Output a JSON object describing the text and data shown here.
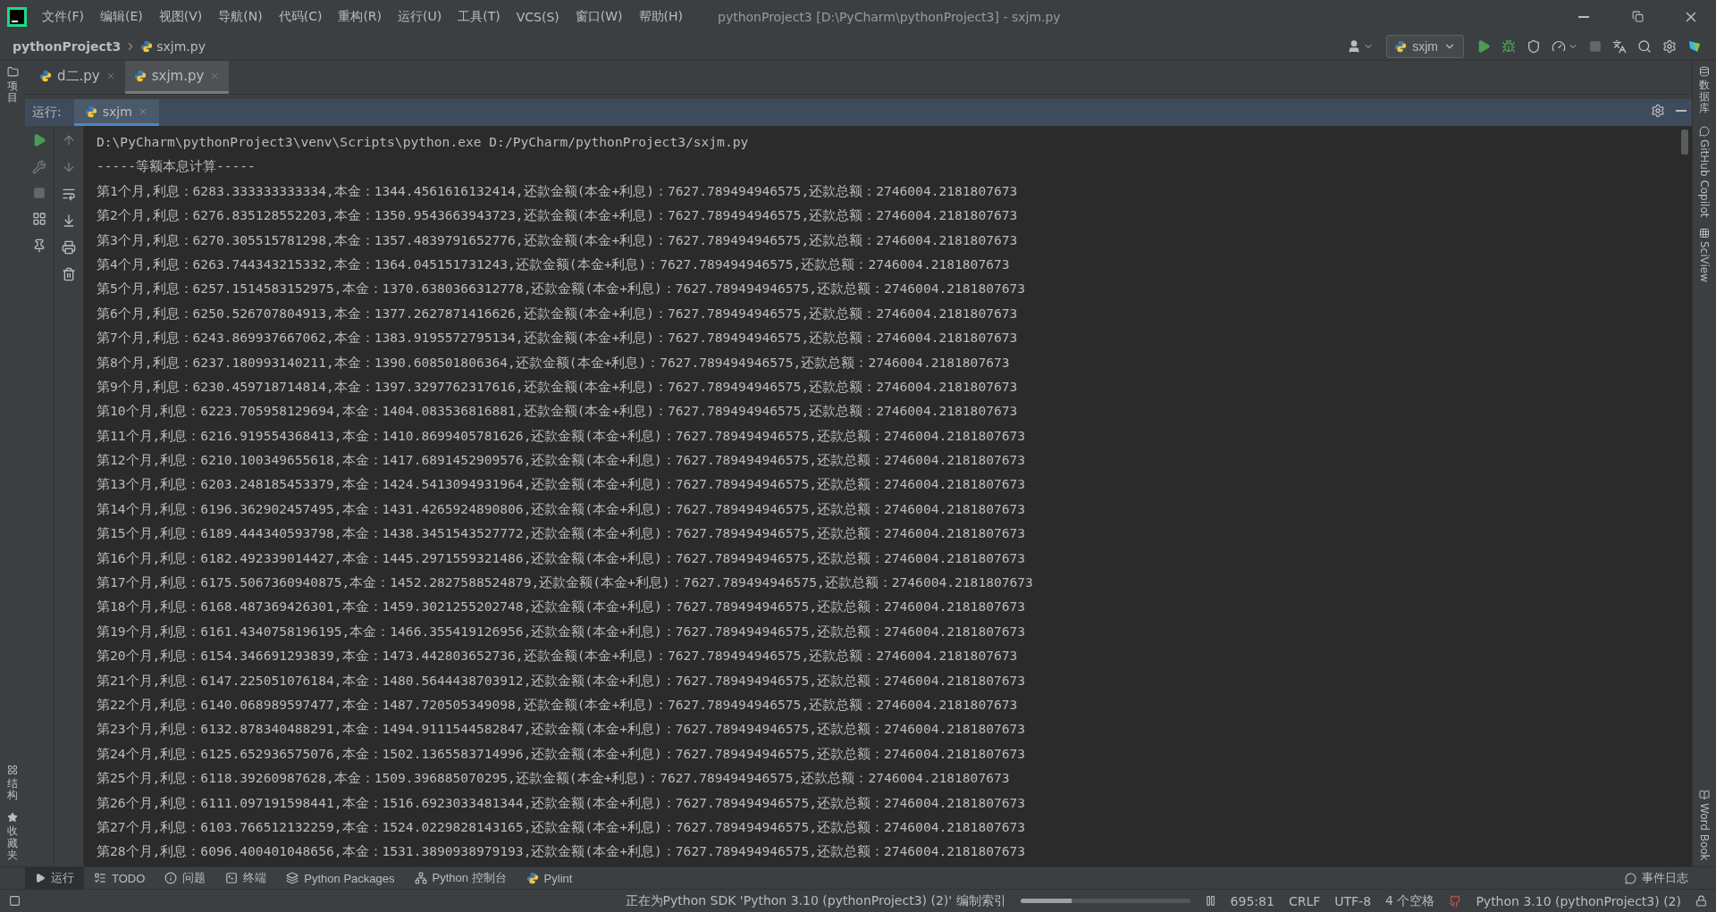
{
  "window": {
    "title": "pythonProject3 [D:\\PyCharm\\pythonProject3] - sxjm.py"
  },
  "menu": [
    "文件(F)",
    "编辑(E)",
    "视图(V)",
    "导航(N)",
    "代码(C)",
    "重构(R)",
    "运行(U)",
    "工具(T)",
    "VCS(S)",
    "窗口(W)",
    "帮助(H)"
  ],
  "breadcrumb": [
    "pythonProject3",
    "sxjm.py"
  ],
  "run_config": "sxjm",
  "editor_tabs": [
    {
      "label": "d二.py",
      "selected": false
    },
    {
      "label": "sxjm.py",
      "selected": true
    }
  ],
  "left_strip": {
    "top": [
      "项目"
    ],
    "bottom": [
      "结构",
      "收藏夹"
    ]
  },
  "right_strip": [
    "数据库",
    "GitHub Copilot",
    "SciView",
    "Word Book"
  ],
  "run_panel": {
    "label": "运行:",
    "tabs": [
      {
        "label": "sxjm",
        "selected": true
      }
    ],
    "lines": [
      "D:\\PyCharm\\pythonProject3\\venv\\Scripts\\python.exe D:/PyCharm/pythonProject3/sxjm.py",
      "-----等额本息计算-----",
      "第1个月,利息：6283.333333333334,本金：1344.4561616132414,还款金额(本金+利息)：7627.789494946575,还款总额：2746004.2181807673",
      "第2个月,利息：6276.835128552203,本金：1350.9543663943723,还款金额(本金+利息)：7627.789494946575,还款总额：2746004.2181807673",
      "第3个月,利息：6270.305515781298,本金：1357.4839791652776,还款金额(本金+利息)：7627.789494946575,还款总额：2746004.2181807673",
      "第4个月,利息：6263.744343215332,本金：1364.045151731243,还款金额(本金+利息)：7627.789494946575,还款总额：2746004.2181807673",
      "第5个月,利息：6257.1514583152975,本金：1370.6380366312778,还款金额(本金+利息)：7627.789494946575,还款总额：2746004.2181807673",
      "第6个月,利息：6250.526707804913,本金：1377.2627871416626,还款金额(本金+利息)：7627.789494946575,还款总额：2746004.2181807673",
      "第7个月,利息：6243.869937667062,本金：1383.9195572795134,还款金额(本金+利息)：7627.789494946575,还款总额：2746004.2181807673",
      "第8个月,利息：6237.180993140211,本金：1390.608501806364,还款金额(本金+利息)：7627.789494946575,还款总额：2746004.2181807673",
      "第9个月,利息：6230.459718714814,本金：1397.3297762317616,还款金额(本金+利息)：7627.789494946575,还款总额：2746004.2181807673",
      "第10个月,利息：6223.705958129694,本金：1404.083536816881,还款金额(本金+利息)：7627.789494946575,还款总额：2746004.2181807673",
      "第11个月,利息：6216.919554368413,本金：1410.8699405781626,还款金额(本金+利息)：7627.789494946575,还款总额：2746004.2181807673",
      "第12个月,利息：6210.100349655618,本金：1417.6891452909576,还款金额(本金+利息)：7627.789494946575,还款总额：2746004.2181807673",
      "第13个月,利息：6203.248185453379,本金：1424.5413094931964,还款金额(本金+利息)：7627.789494946575,还款总额：2746004.2181807673",
      "第14个月,利息：6196.362902457495,本金：1431.4265924890806,还款金额(本金+利息)：7627.789494946575,还款总额：2746004.2181807673",
      "第15个月,利息：6189.444340593798,本金：1438.3451543527772,还款金额(本金+利息)：7627.789494946575,还款总额：2746004.2181807673",
      "第16个月,利息：6182.492339014427,本金：1445.2971559321486,还款金额(本金+利息)：7627.789494946575,还款总额：2746004.2181807673",
      "第17个月,利息：6175.5067360940875,本金：1452.2827588524879,还款金额(本金+利息)：7627.789494946575,还款总额：2746004.2181807673",
      "第18个月,利息：6168.487369426301,本金：1459.3021255202748,还款金额(本金+利息)：7627.789494946575,还款总额：2746004.2181807673",
      "第19个月,利息：6161.4340758196195,本金：1466.355419126956,还款金额(本金+利息)：7627.789494946575,还款总额：2746004.2181807673",
      "第20个月,利息：6154.346691293839,本金：1473.442803652736,还款金额(本金+利息)：7627.789494946575,还款总额：2746004.2181807673",
      "第21个月,利息：6147.225051076184,本金：1480.5644438703912,还款金额(本金+利息)：7627.789494946575,还款总额：2746004.2181807673",
      "第22个月,利息：6140.068989597477,本金：1487.720505349098,还款金额(本金+利息)：7627.789494946575,还款总额：2746004.2181807673",
      "第23个月,利息：6132.878340488291,本金：1494.9111544582847,还款金额(本金+利息)：7627.789494946575,还款总额：2746004.2181807673",
      "第24个月,利息：6125.652936575076,本金：1502.1365583714996,还款金额(本金+利息)：7627.789494946575,还款总额：2746004.2181807673",
      "第25个月,利息：6118.39260987628,本金：1509.396885070295,还款金额(本金+利息)：7627.789494946575,还款总额：2746004.2181807673",
      "第26个月,利息：6111.097191598441,本金：1516.6923033481344,还款金额(本金+利息)：7627.789494946575,还款总额：2746004.2181807673",
      "第27个月,利息：6103.766512132259,本金：1524.0229828143165,还款金额(本金+利息)：7627.789494946575,还款总额：2746004.2181807673",
      "第28个月,利息：6096.400401048656,本金：1531.3890938979193,还款金额(本金+利息)：7627.789494946575,还款总额：2746004.2181807673"
    ]
  },
  "tool_windows": [
    {
      "label": "运行",
      "kind": "run",
      "selected": true
    },
    {
      "label": "TODO",
      "kind": "todo",
      "selected": false
    },
    {
      "label": "问题",
      "kind": "problems",
      "selected": false
    },
    {
      "label": "终端",
      "kind": "terminal",
      "selected": false
    },
    {
      "label": "Python Packages",
      "kind": "packages",
      "selected": false
    },
    {
      "label": "Python 控制台",
      "kind": "console",
      "selected": false
    },
    {
      "label": "Pylint",
      "kind": "pylint",
      "selected": false
    }
  ],
  "event_log": "事件日志",
  "status_bar": {
    "message": "正在为Python SDK 'Python 3.10 (pythonProject3) (2)' 编制索引",
    "progress": {
      "level": 0.3
    },
    "position": "695:81",
    "line_ending": "CRLF",
    "encoding": "UTF-8",
    "indent": "4 个空格",
    "interpreter": "Python 3.10 (pythonProject3) (2)"
  }
}
